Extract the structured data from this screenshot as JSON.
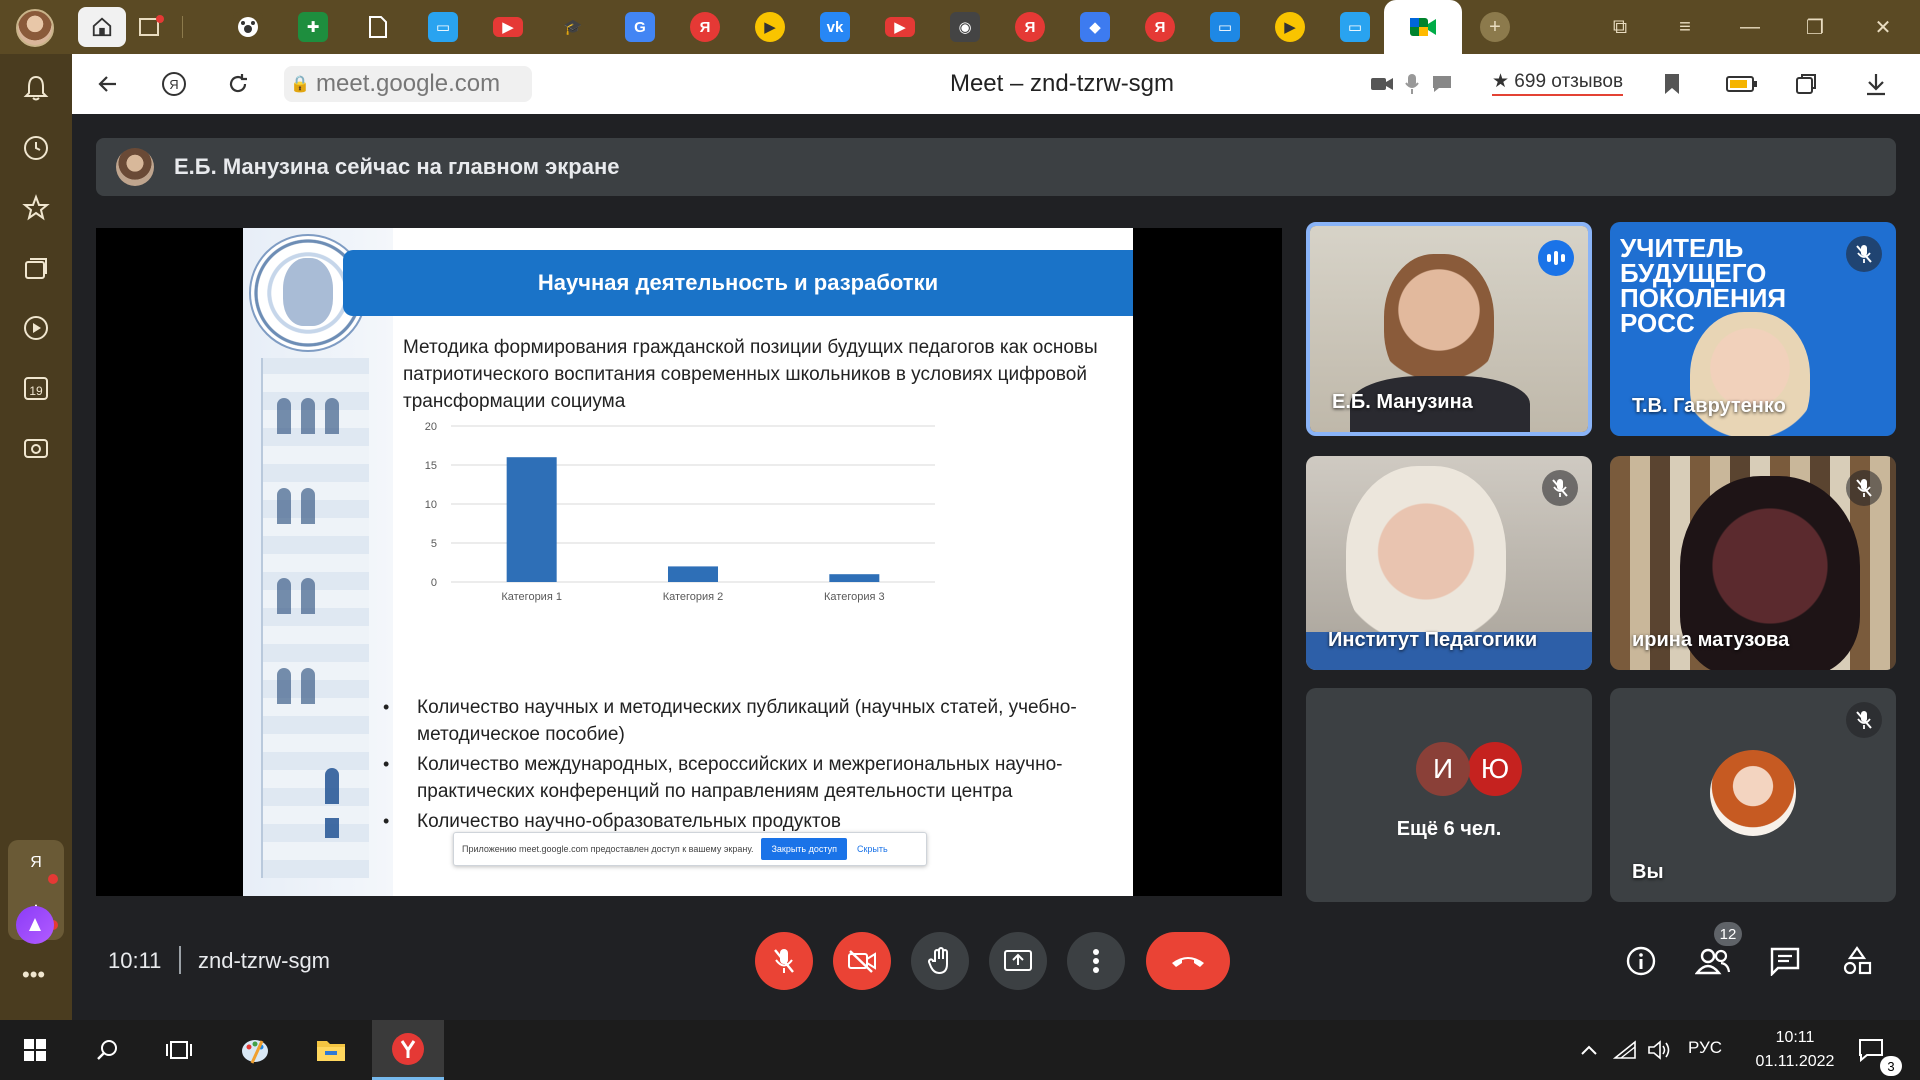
{
  "browser": {
    "url": "meet.google.com",
    "page_title": "Meet – znd-tzrw-sgm",
    "reviews": "★ 699 отзывов",
    "tab_icons": [
      "home-tab",
      "new-tab-add",
      "paw-app",
      "green-sheets",
      "document",
      "chat-app",
      "youtube",
      "mortarboard",
      "translate",
      "yandex",
      "play",
      "vk",
      "youtube",
      "video-app",
      "yandex",
      "cube-app",
      "yandex",
      "chat-app",
      "play",
      "chat-app"
    ]
  },
  "sidebar": {
    "items": [
      "bell-icon",
      "clock-icon",
      "star-icon",
      "collections-icon",
      "video-icon",
      "calendar-icon",
      "screenshot-icon"
    ],
    "calendar_day": "19",
    "bottom_letter": "Я"
  },
  "presenting": {
    "text": "Е.Б. Манузина сейчас на главном экране"
  },
  "slide": {
    "title": "Научная деятельность и разработки",
    "subtitle": "Методика формирования гражданской позиции будущих педагогов как основы патриотического воспитания современных школьников в условиях цифровой трансформации социума",
    "bullets": [
      "Количество научных и методических публикаций (научных статей, учебно-методическое пособие)",
      "Количество международных, всероссийских и межрегиональных научно-практических конференций по направлениям деятельности центра",
      "Количество научно-образовательных продуктов"
    ],
    "share_notice": {
      "text": "Приложению meet.google.com предоставлен доступ к вашему экрану.",
      "stop": "Закрыть доступ",
      "hide": "Скрыть"
    }
  },
  "chart_data": {
    "type": "bar",
    "categories": [
      "Категория 1",
      "Категория 2",
      "Категория 3"
    ],
    "values": [
      16,
      2,
      1
    ],
    "ylim": [
      0,
      20
    ],
    "yticks": [
      0,
      5,
      10,
      15,
      20
    ],
    "title": "",
    "xlabel": "",
    "ylabel": "",
    "grid": true,
    "bar_color": "#2e6fb7"
  },
  "participants": [
    {
      "name": "Е.Б. Манузина",
      "speaking": true,
      "muted": false
    },
    {
      "name": "Т.В. Гаврутенко",
      "speaking": false,
      "muted": true,
      "banner": "УЧИТЕЛЬ БУДУЩЕГО ПОКОЛЕНИЯ РОСС"
    },
    {
      "name": "Институт Педагогики",
      "speaking": false,
      "muted": true
    },
    {
      "name": "ирина матузова",
      "speaking": false,
      "muted": true
    }
  ],
  "others": {
    "initials": [
      "И",
      "Ю"
    ],
    "label": "Ещё 6 чел."
  },
  "self": {
    "name": "Вы",
    "muted": true
  },
  "controls": {
    "time": "10:11",
    "meeting_code": "znd-tzrw-sgm",
    "people_count": "12"
  },
  "taskbar": {
    "lang": "РУС",
    "time": "10:11",
    "date": "01.11.2022",
    "notifications": "3"
  },
  "colors": {
    "meet_bg": "#202124",
    "tile_bg": "#3c4043",
    "red": "#ea4335",
    "speaking_blue": "#8ab4f8",
    "slide_blue": "#1a73c8"
  }
}
